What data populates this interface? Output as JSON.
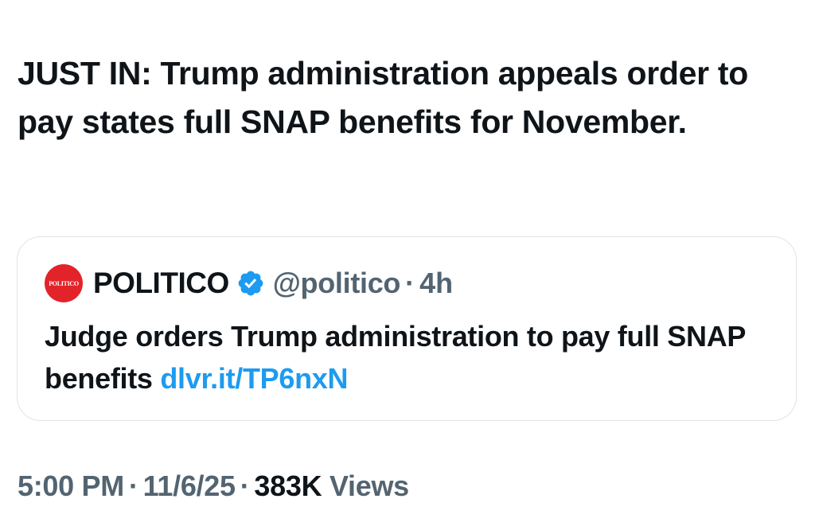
{
  "tweet": {
    "text": "JUST IN: Trump administration appeals order to pay states full SNAP benefits for November."
  },
  "quote": {
    "avatar_text": "POLITICO",
    "author_name": "POLITICO",
    "verified": true,
    "badge_color": "#1d9bf0",
    "handle": "@politico",
    "separator": "·",
    "time_ago": "4h",
    "text": "Judge orders Trump administration to pay full SNAP benefits",
    "link_text": "dlvr.it/TP6nxN",
    "avatar_color": "#e3232a"
  },
  "meta": {
    "time": "5:00 PM",
    "separator": "·",
    "date": "11/6/25",
    "views_count": "383K",
    "views_label": "Views"
  },
  "colors": {
    "text_primary": "#0f1419",
    "text_secondary": "#536471",
    "link": "#1d9bf0",
    "card_border": "#dfe3e7"
  }
}
